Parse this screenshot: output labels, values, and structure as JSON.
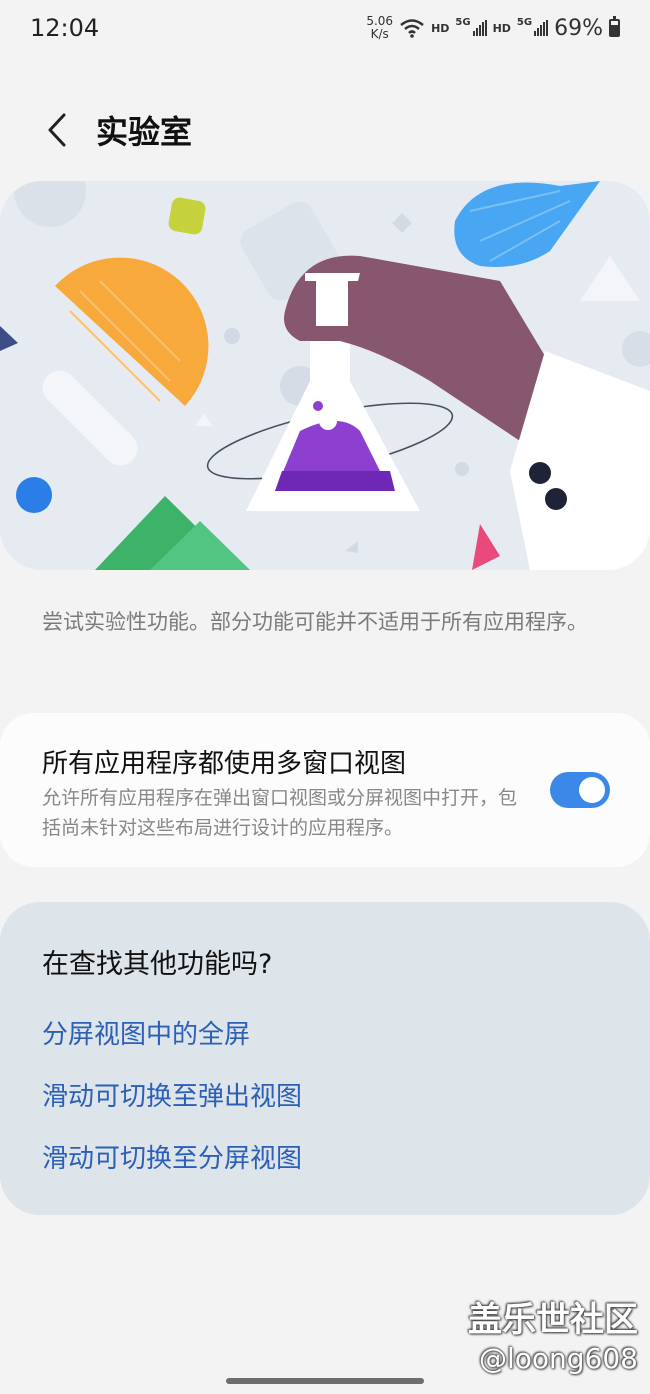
{
  "status_bar": {
    "time": "12:04",
    "net_speed_value": "5.06",
    "net_speed_unit": "K/s",
    "hd_label_1": "HD",
    "network_1": "5G",
    "hd_label_2": "HD",
    "network_2": "5G",
    "battery_percent": "69%"
  },
  "header": {
    "title": "实验室",
    "back_icon": "chevron-left-icon"
  },
  "description": "尝试实验性功能。部分功能可能并不适用于所有应用程序。",
  "feature": {
    "title": "所有应用程序都使用多窗口视图",
    "description": "允许所有应用程序在弹出窗口视图或分屏视图中打开，包括尚未针对这些布局进行设计的应用程序。",
    "enabled": true
  },
  "suggestions": {
    "title": "在查找其他功能吗?",
    "links": [
      "分屏视图中的全屏",
      "滑动可切换至弹出视图",
      "滑动可切换至分屏视图"
    ]
  },
  "watermark": {
    "title": "盖乐世社区",
    "handle": "@loong608"
  },
  "colors": {
    "accent": "#3b88e8",
    "link": "#2c5fb7",
    "background": "#f3f3f3"
  }
}
